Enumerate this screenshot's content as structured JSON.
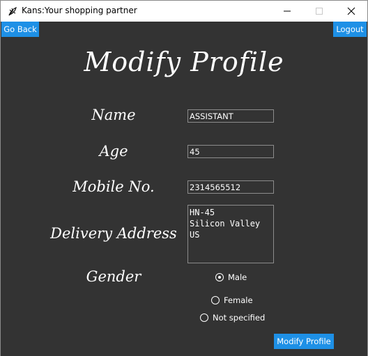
{
  "window": {
    "title": "Kans:Your shopping partner"
  },
  "nav": {
    "go_back": "Go Back",
    "logout": "Logout"
  },
  "page": {
    "title": "Modify Profile"
  },
  "form": {
    "name_label": "Name",
    "name_value": "ASSISTANT",
    "age_label": "Age",
    "age_value": "45",
    "mobile_label": "Mobile No.",
    "mobile_value": "2314565512",
    "address_label": "Delivery Address",
    "address_value": "HN-45\nSilicon Valley\nUS",
    "gender_label": "Gender",
    "gender_options": [
      "Male",
      "Female",
      "Not specified"
    ],
    "gender_selected": "Male",
    "submit_label": "Modify Profile"
  },
  "colors": {
    "background": "#333333",
    "accent": "#1e90e6",
    "text": "#ffffff"
  },
  "icons": {
    "app": "feather-app-icon",
    "minimize": "minimize-icon",
    "maximize": "maximize-icon",
    "close": "close-icon"
  }
}
